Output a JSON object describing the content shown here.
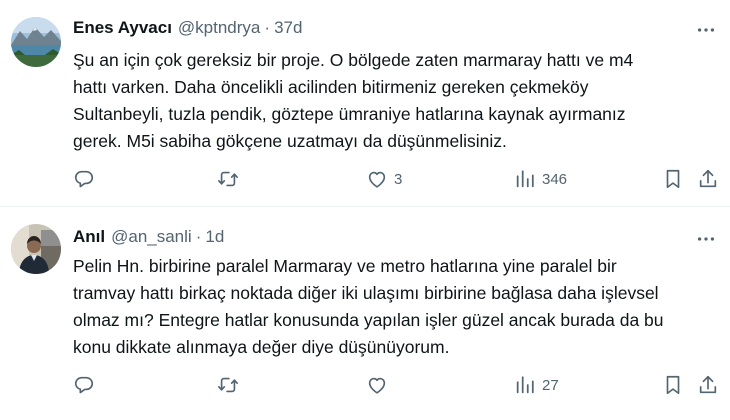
{
  "tweets": [
    {
      "author": "Enes Ayvacı",
      "handle": "@kptndrya",
      "separator": "·",
      "time": "37d",
      "text_lines": [
        "Şu an için çok gereksiz bir proje. O bölgede zaten marmaray hattı ve m4",
        "hattı varken. Daha öncelikli acilinden bitirmeniz gereken çekmeköy",
        "Sultanbeyli, tuzla pendik, göztepe ümraniye hatlarına kaynak ayırmanız",
        "gerek. M5i sabiha gökçene uzatmayı da düşünmelisiniz."
      ],
      "replies": "",
      "retweets": "",
      "likes": "3",
      "views": "346"
    },
    {
      "author": "Anıl",
      "handle": "@an_sanli",
      "separator": "·",
      "time": "1d",
      "text_lines": [
        "Pelin Hn. birbirine paralel Marmaray ve metro hatlarına yine paralel bir",
        "tramvay hattı birkaç noktada diğer iki ulaşımı birbirine bağlasa daha işlevsel",
        "olmaz mı? Entegre hatlar konusunda yapılan işler güzel ancak burada da bu",
        "konu dikkate alınmaya değer diye düşünüyorum."
      ],
      "replies": "",
      "retweets": "",
      "likes": "",
      "views": "27"
    }
  ],
  "icons": {
    "more": "more-horizontal-icon",
    "reply": "reply-icon",
    "retweet": "retweet-icon",
    "like": "heart-icon",
    "views": "views-icon",
    "bookmark": "bookmark-icon",
    "share": "share-icon"
  },
  "colors": {
    "text": "#0f1419",
    "secondary": "#536471",
    "divider": "#eff3f4"
  }
}
